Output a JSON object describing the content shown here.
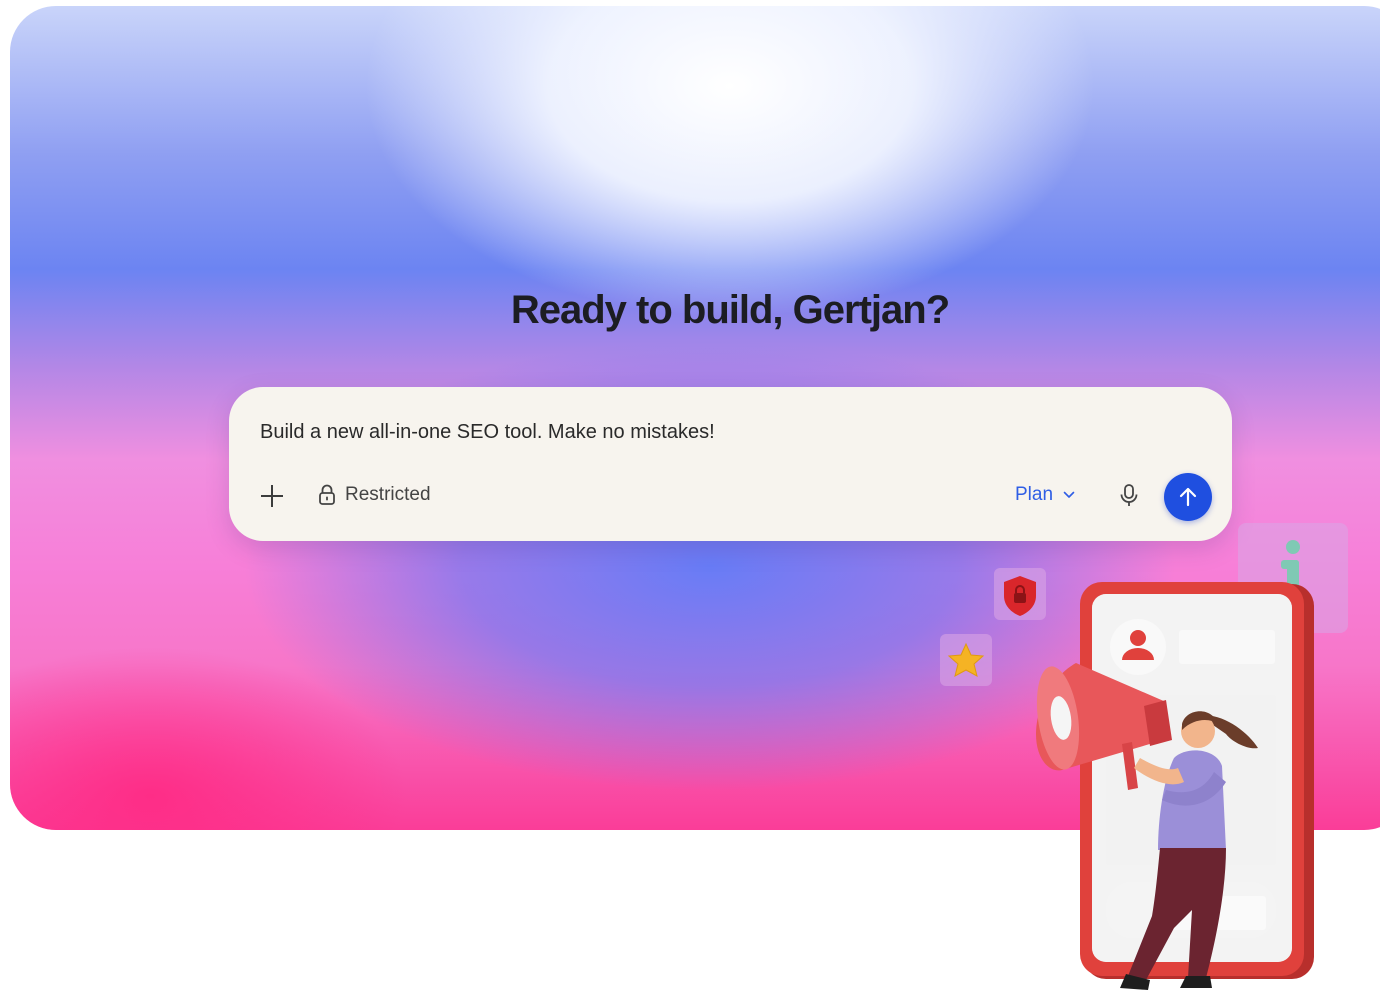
{
  "hero": {
    "headline": "Ready to build, Gertjan?"
  },
  "prompt": {
    "value": "Build a new all-in-one SEO tool. Make no mistakes!",
    "restricted_label": "Restricted",
    "mode_label": "Plan"
  },
  "icons": {
    "attach": "plus-icon",
    "visibility": "lock-icon",
    "mode_toggle": "chevron-down-icon",
    "voice": "microphone-icon",
    "send": "arrow-up-icon"
  },
  "colors": {
    "accent": "#1f4fe0",
    "plan_text": "#2f5ee5",
    "card_bg": "#f7f4ee",
    "phone_red": "#e0413c",
    "shirt": "#9b8fd8",
    "pants": "#6b2430"
  }
}
